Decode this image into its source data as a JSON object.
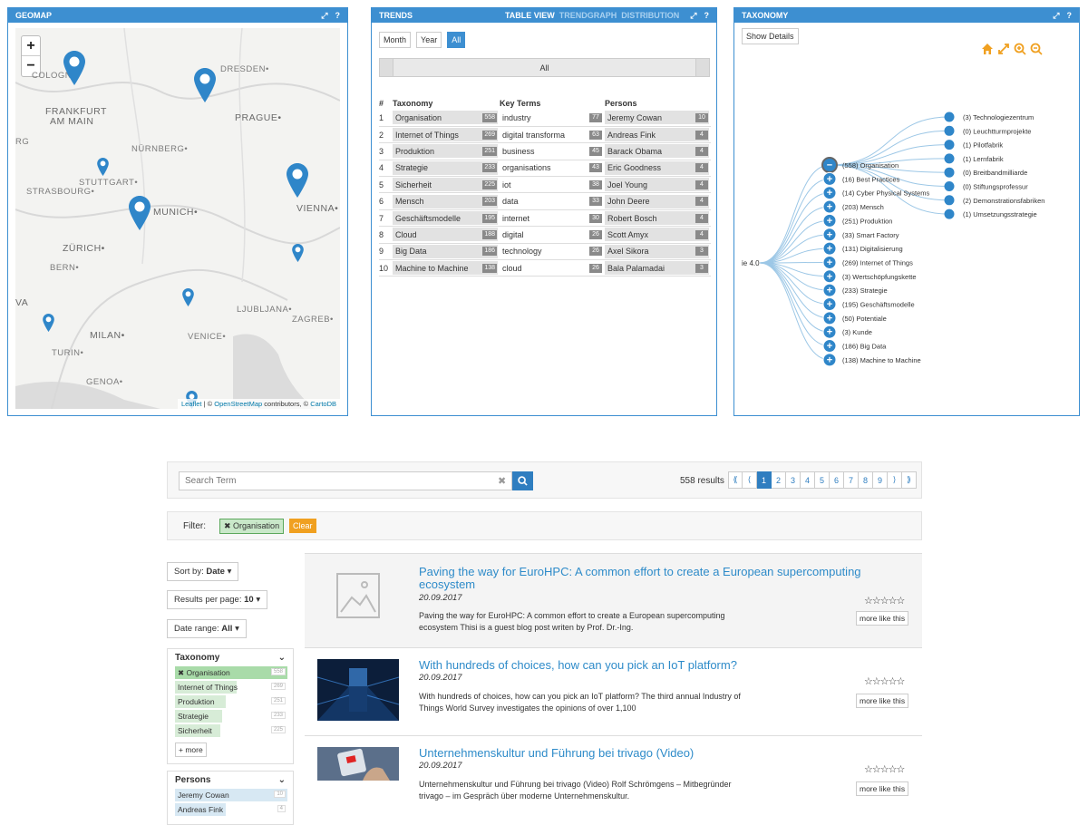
{
  "geomap": {
    "title": "GEOMAP",
    "zoom_in": "+",
    "zoom_out": "−",
    "cities": [
      {
        "label": "DRESDEN•"
      },
      {
        "label": "COLOGNE"
      },
      {
        "label": "FRANKFURT"
      },
      {
        "label": "AM MAIN"
      },
      {
        "label": "PRAGUE•"
      },
      {
        "label": "NÜRNBERG•"
      },
      {
        "label": "STUTTGART•"
      },
      {
        "label": "STRASBOURG•"
      },
      {
        "label": "MUNICH•"
      },
      {
        "label": "VIENNA•"
      },
      {
        "label": "ZÜRICH•"
      },
      {
        "label": "BERN•"
      },
      {
        "label": "LJUBLJANA•"
      },
      {
        "label": "ZAGREB•"
      },
      {
        "label": "MILAN•"
      },
      {
        "label": "VENICE•"
      },
      {
        "label": "TURIN•"
      },
      {
        "label": "GENOA•"
      },
      {
        "label": "VA"
      },
      {
        "label": "RG"
      }
    ],
    "attribution_leaflet": "Leaflet",
    "attribution_mid": " | © ",
    "attribution_osm": "OpenStreetMap",
    "attribution_contrib": " contributors, © ",
    "attribution_carto": "CartoDB"
  },
  "trends": {
    "title": "TRENDS",
    "tab_table": "TABLE VIEW",
    "tab_trendgraph": "TRENDGRAPH",
    "tab_distribution": "DISTRIBUTION",
    "btn_month": "Month",
    "btn_year": "Year",
    "btn_all": "All",
    "range_label": "All",
    "headers": {
      "num": "#",
      "taxonomy": "Taxonomy",
      "key_terms": "Key Terms",
      "persons": "Persons"
    },
    "rows": [
      {
        "n": "1",
        "tax": "Organisation",
        "tax_c": "558",
        "term": "industry",
        "term_c": "77",
        "person": "Jeremy Cowan",
        "person_c": "10"
      },
      {
        "n": "2",
        "tax": "Internet of Things",
        "tax_c": "269",
        "term": "digital transforma",
        "term_c": "63",
        "person": "Andreas Fink",
        "person_c": "4"
      },
      {
        "n": "3",
        "tax": "Produktion",
        "tax_c": "251",
        "term": "business",
        "term_c": "45",
        "person": "Barack Obama",
        "person_c": "4"
      },
      {
        "n": "4",
        "tax": "Strategie",
        "tax_c": "233",
        "term": "organisations",
        "term_c": "43",
        "person": "Eric Goodness",
        "person_c": "4"
      },
      {
        "n": "5",
        "tax": "Sicherheit",
        "tax_c": "225",
        "term": "iot",
        "term_c": "38",
        "person": "Joel Young",
        "person_c": "4"
      },
      {
        "n": "6",
        "tax": "Mensch",
        "tax_c": "203",
        "term": "data",
        "term_c": "33",
        "person": "John Deere",
        "person_c": "4"
      },
      {
        "n": "7",
        "tax": "Geschäftsmodelle",
        "tax_c": "195",
        "term": "internet",
        "term_c": "30",
        "person": "Robert Bosch",
        "person_c": "4"
      },
      {
        "n": "8",
        "tax": "Cloud",
        "tax_c": "188",
        "term": "digital",
        "term_c": "26",
        "person": "Scott Amyx",
        "person_c": "4"
      },
      {
        "n": "9",
        "tax": "Big Data",
        "tax_c": "186",
        "term": "technology",
        "term_c": "26",
        "person": "Axel Sikora",
        "person_c": "3"
      },
      {
        "n": "10",
        "tax": "Machine to Machine",
        "tax_c": "138",
        "term": "cloud",
        "term_c": "26",
        "person": "Bala Palamadai",
        "person_c": "3"
      }
    ]
  },
  "taxonomy": {
    "title": "TAXONOMY",
    "show_details": "Show Details",
    "root_label": "ie 4.0",
    "main_nodes": [
      {
        "label": "(558) Organisation",
        "sign": "−"
      },
      {
        "label": "(16) Best Practices",
        "sign": "+"
      },
      {
        "label": "(14) Cyber Physical Systems",
        "sign": "+"
      },
      {
        "label": "(203) Mensch",
        "sign": "+"
      },
      {
        "label": "(251) Produktion",
        "sign": "+"
      },
      {
        "label": "(33) Smart Factory",
        "sign": "+"
      },
      {
        "label": "(131) Digitalisierung",
        "sign": "+"
      },
      {
        "label": "(269) Internet of Things",
        "sign": "+"
      },
      {
        "label": "(3) Wertschöpfungskette",
        "sign": "+"
      },
      {
        "label": "(233) Strategie",
        "sign": "+"
      },
      {
        "label": "(195) Geschäftsmodelle",
        "sign": "+"
      },
      {
        "label": "(50) Potentiale",
        "sign": "+"
      },
      {
        "label": "(3) Kunde",
        "sign": "+"
      },
      {
        "label": "(186) Big Data",
        "sign": "+"
      },
      {
        "label": "(138) Machine to Machine",
        "sign": "+"
      }
    ],
    "child_nodes": [
      "(3) Technologiezentrum",
      "(0) Leuchtturmprojekte",
      "(1) Pilotfabrik",
      "(1) Lernfabrik",
      "(0) Breitbandmilliarde",
      "(0) Stiftungsprofessur",
      "(2) Demonstrationsfabriken",
      "(1) Umsetzungsstrategie"
    ]
  },
  "search": {
    "placeholder": "Search Term",
    "clear": "✖",
    "results_count": "558 results",
    "pager": [
      "⟪",
      "⟨",
      "1",
      "2",
      "3",
      "4",
      "5",
      "6",
      "7",
      "8",
      "9",
      "⟩",
      "⟫"
    ]
  },
  "filter": {
    "label": "Filter:",
    "chip": "✖ Organisation",
    "clear": "Clear"
  },
  "controls": {
    "sort_prefix": "Sort by: ",
    "sort_value": "Date",
    "rpp_prefix": "Results per page: ",
    "rpp_value": "10",
    "range_prefix": "Date range: ",
    "range_value": "All",
    "caret": "▾"
  },
  "facets": {
    "taxonomy": {
      "title": "Taxonomy",
      "items": [
        {
          "label": "✖ Organisation",
          "count": "558",
          "fill": 1.0
        },
        {
          "label": "Internet of Things",
          "count": "269",
          "fill": 0.55
        },
        {
          "label": "Produktion",
          "count": "251",
          "fill": 0.45
        },
        {
          "label": "Strategie",
          "count": "233",
          "fill": 0.42
        },
        {
          "label": "Sicherheit",
          "count": "225",
          "fill": 0.4
        }
      ],
      "more": "+ more"
    },
    "persons": {
      "title": "Persons",
      "items": [
        {
          "label": "Jeremy Cowan",
          "count": "10",
          "fill": 1.0
        },
        {
          "label": "Andreas Fink",
          "count": "4",
          "fill": 0.45
        }
      ]
    }
  },
  "results": [
    {
      "title": "Paving the way for EuroHPC: A common effort to create a European supercomputing ecosystem",
      "date": "20.09.2017",
      "snippet": "Paving the way for EuroHPC: A common effort to create a European supercomputing ecosystem Thisi is a guest blog post writen by Prof. Dr.-Ing.",
      "stars": "☆☆☆☆☆",
      "more_like_this": "more like this"
    },
    {
      "title": "With hundreds of choices, how can you pick an IoT platform?",
      "date": "20.09.2017",
      "snippet": "With hundreds of choices, how can you pick an IoT platform? The third annual Industry of Things World Survey investigates the opinions of over 1,100",
      "stars": "☆☆☆☆☆",
      "more_like_this": "more like this"
    },
    {
      "title": "Unternehmenskultur und Führung bei trivago (Video)",
      "date": "20.09.2017",
      "snippet": "Unternehmenskultur und Führung bei trivago (Video) Rolf Schrömgens – Mitbegründer trivago – im Gespräch über moderne Unternehmenskultur.",
      "stars": "☆☆☆☆☆",
      "more_like_this": "more like this"
    }
  ],
  "colors": {
    "accent": "#3d8fd1",
    "link": "#2e8bc9",
    "pin": "#2f86c9",
    "tool_orange": "#f0a020"
  }
}
